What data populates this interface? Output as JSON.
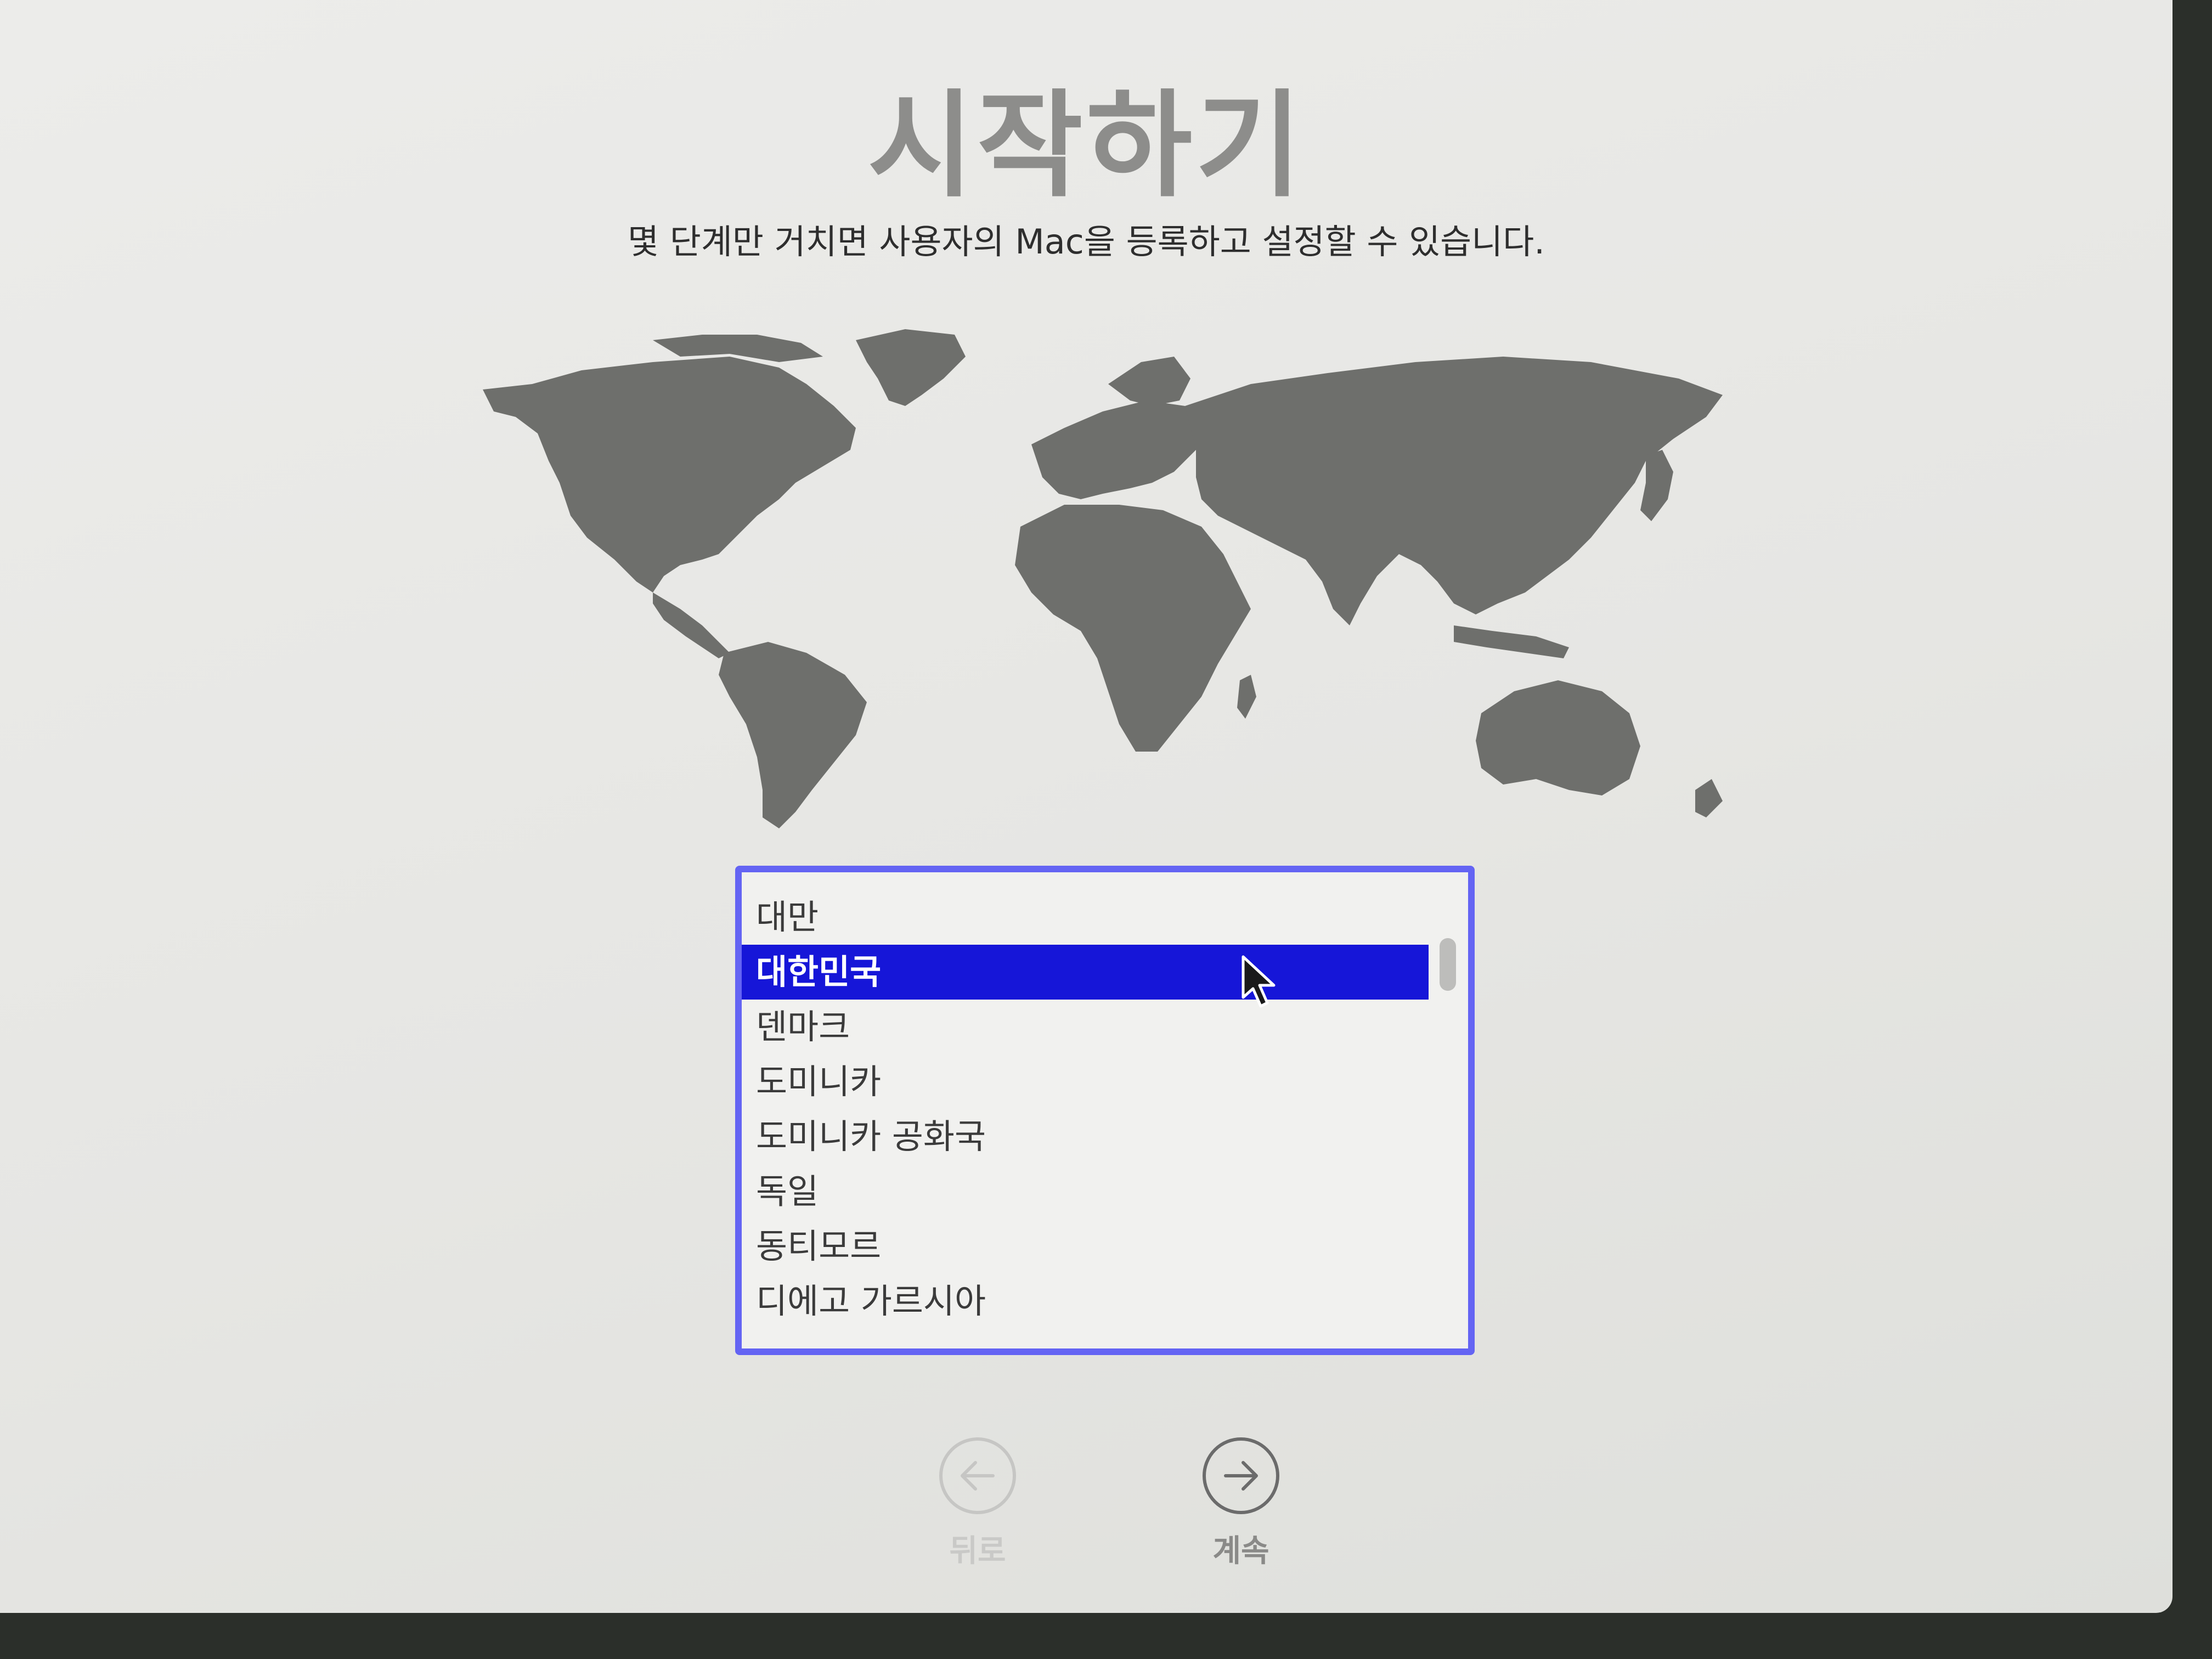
{
  "title": "시작하기",
  "subtitle": "몇 단계만 거치면 사용자의 Mac을 등록하고 설정할 수 있습니다.",
  "country_list": {
    "items": [
      "대만",
      "대한민국",
      "덴마크",
      "도미니카",
      "도미니카 공화국",
      "독일",
      "동티모르",
      "디에고 가르시아"
    ],
    "selected": "대한민국"
  },
  "navigation": {
    "back_label": "뒤로",
    "next_label": "계속"
  },
  "colors": {
    "selection": "#1616d8",
    "focus_ring": "#6464f3",
    "map_land": "#6e6f6c"
  }
}
